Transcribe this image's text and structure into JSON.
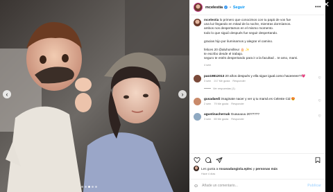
{
  "modal": {
    "close_glyph": "✕"
  },
  "post": {
    "username": "mcelestia",
    "verified_glyph": "✓",
    "separator": "•",
    "follow_label": "Seguir",
    "more_glyph": "•••"
  },
  "media": {
    "prev_glyph": "‹",
    "next_glyph": "›",
    "dot_count": 5,
    "active_dot": 2
  },
  "caption": {
    "username": "mcelestia",
    "lines": [
      "lo primero que conocimos con tu papá de vos fue",
      "una luz llegando en mitad de la noche, mientras dormíamos.",
      "ambos nos despertamos en el mismo momento.",
      "todo lo que siguió después fue seguir despertando.",
      "",
      "gracias hijo por iluminarnos y alegrar el camino.",
      "",
      "felices 20 @aluhorvilleur 🎂 ✨",
      "te escribo desde el trabajo.",
      "seguro te estés despertando para ir a la facultad .. te amo, mami."
    ],
    "time": "4 sem"
  },
  "comments": [
    {
      "username": "pao19812013",
      "text": "20 años después y ella sigue igual.como haceeeee?!💗",
      "time": "3 sem",
      "likes": "217 Me gusta",
      "reply": "Responder",
      "view_replies": "Ver respuestas (1)",
      "avatar_color": "#7a4a3a"
    },
    {
      "username": "gusadaedi",
      "text": "imaginate nacer y ver q tu mamá es Celeste Cid 😍",
      "time": "2 sem",
      "likes": "79 Me gusta",
      "reply": "Responder",
      "avatar_color": "#c98a6a"
    },
    {
      "username": "agustinachernak",
      "text": "Guauuuuu 20?????",
      "time": "3 sem",
      "likes": "65 Me gusta",
      "reply": "Responder",
      "avatar_color": "#8fa9c2"
    }
  ],
  "actions": {
    "heart_icon": "heart-icon",
    "comment_icon": "comment-icon",
    "share_icon": "share-icon",
    "bookmark_icon": "bookmark-icon"
  },
  "likes": {
    "prefix": "Les gusta a ",
    "user": "roxanadangiola.eplec",
    "suffix": " y ",
    "others": "personas más"
  },
  "post_time": "Hace 4 días",
  "add_comment": {
    "emoji_glyph": "☺",
    "placeholder": "Añade un comentario...",
    "publish_label": "Publicar"
  }
}
